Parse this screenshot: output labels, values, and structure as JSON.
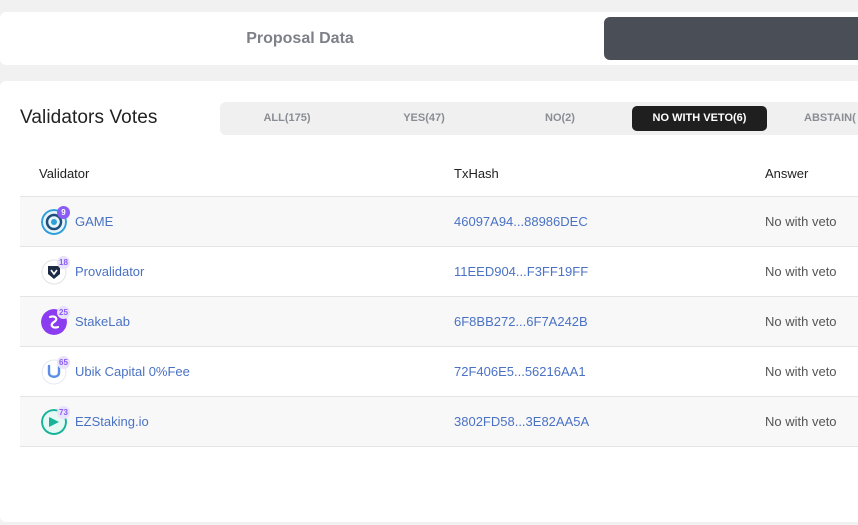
{
  "tabs": {
    "proposal_data": "Proposal Data"
  },
  "votes": {
    "title": "Validators Votes",
    "filters": [
      {
        "label": "ALL(175)",
        "active": false
      },
      {
        "label": "YES(47)",
        "active": false
      },
      {
        "label": "NO(2)",
        "active": false
      },
      {
        "label": "NO WITH VETO(6)",
        "active": true
      },
      {
        "label": "ABSTAIN(",
        "active": false
      }
    ],
    "columns": {
      "validator": "Validator",
      "txhash": "TxHash",
      "answer": "Answer"
    },
    "rows": [
      {
        "rank": "9",
        "name": "GAME",
        "txhash": "46097A94...88986DEC",
        "answer": "No with veto",
        "icon": "game-logo-icon",
        "icon_color": "#2e9fd8",
        "badge_color": "#8b5cf6"
      },
      {
        "rank": "18",
        "name": "Provalidator",
        "txhash": "11EED904...F3FF19FF",
        "answer": "No with veto",
        "icon": "provalidator-logo-icon",
        "icon_color": "#1d2a44",
        "badge_color": "#e9e2fb"
      },
      {
        "rank": "25",
        "name": "StakeLab",
        "txhash": "6F8BB272...6F7A242B",
        "answer": "No with veto",
        "icon": "stakelab-logo-icon",
        "icon_color": "#8b3cf0",
        "badge_color": "#e9e2fb"
      },
      {
        "rank": "65",
        "name": "Ubik Capital 0%Fee",
        "txhash": "72F406E5...56216AA1",
        "answer": "No with veto",
        "icon": "ubik-logo-icon",
        "icon_color": "#5b8fe6",
        "badge_color": "#e9e2fb"
      },
      {
        "rank": "73",
        "name": "EZStaking.io",
        "txhash": "3802FD58...3E82AA5A",
        "answer": "No with veto",
        "icon": "ezstaking-logo-icon",
        "icon_color": "#16b39a",
        "badge_color": "#e9e2fb"
      }
    ]
  }
}
